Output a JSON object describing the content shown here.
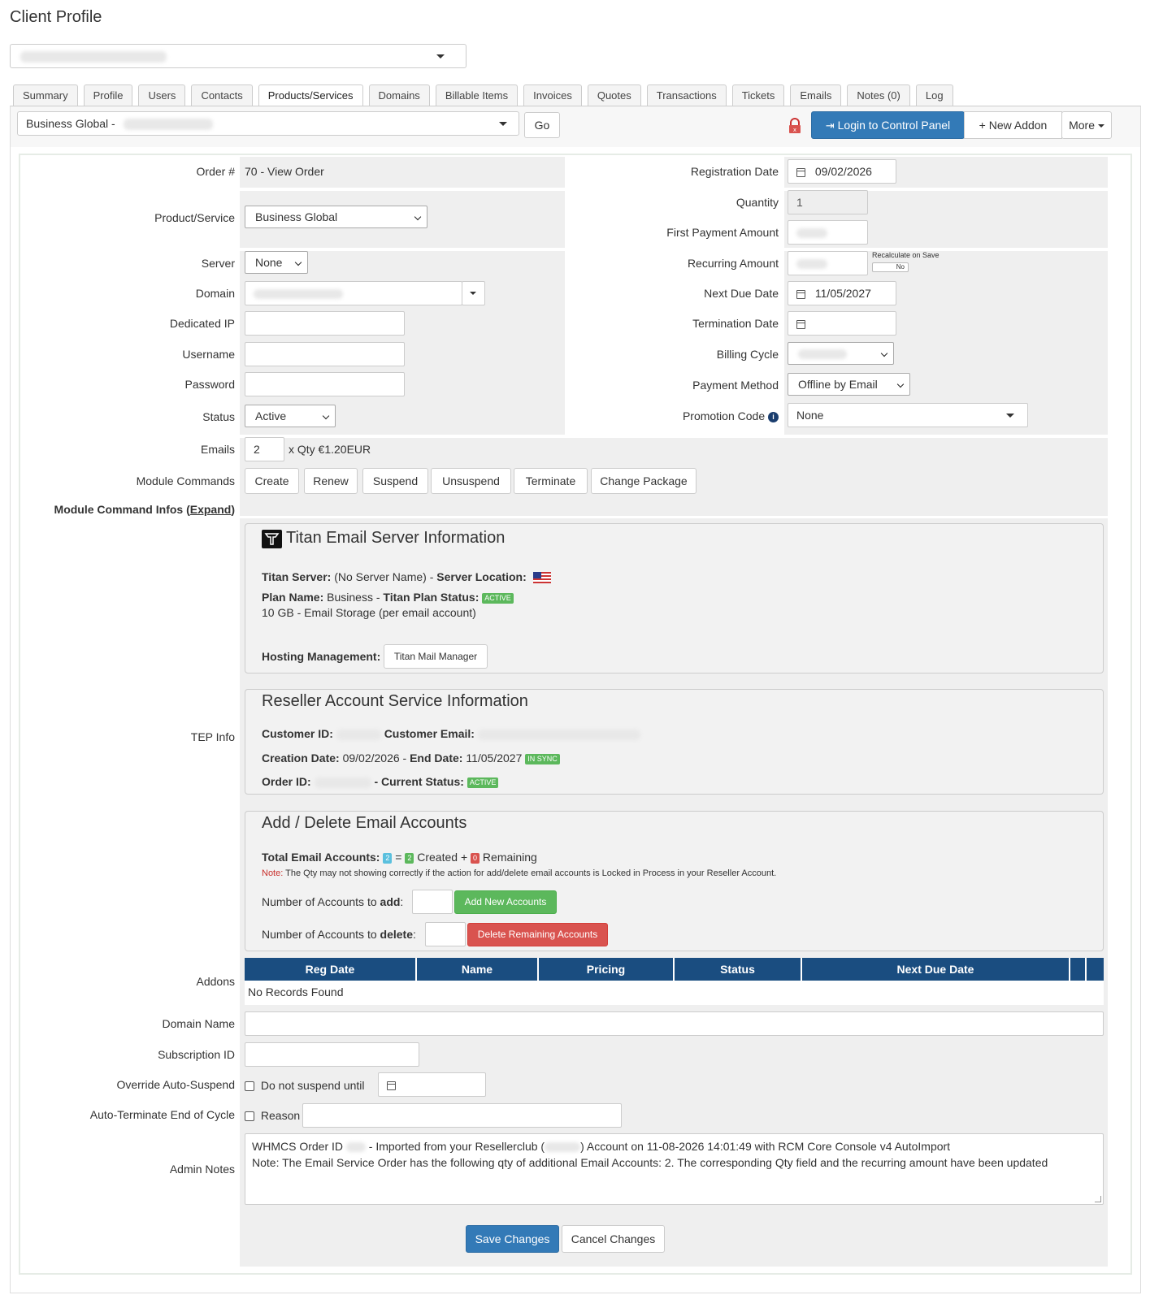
{
  "page": {
    "title": "Client Profile"
  },
  "tabs": [
    "Summary",
    "Profile",
    "Users",
    "Contacts",
    "Products/Services",
    "Domains",
    "Billable Items",
    "Invoices",
    "Quotes",
    "Transactions",
    "Tickets",
    "Emails",
    "Notes (0)",
    "Log"
  ],
  "toolbar": {
    "product_select": "Business Global -",
    "go": "Go",
    "login": "Login to Control Panel",
    "new_addon": "New Addon",
    "more": "More"
  },
  "form": {
    "order_label": "Order #",
    "order_value": "70 - View Order",
    "product_label": "Product/Service",
    "product_value": "Business Global",
    "server_label": "Server",
    "server_value": "None",
    "domain_label": "Domain",
    "dedicated_ip_label": "Dedicated IP",
    "username_label": "Username",
    "password_label": "Password",
    "status_label": "Status",
    "status_value": "Active",
    "emails_label": "Emails",
    "emails_value": "2",
    "emails_suffix": "x Qty €1.20EUR",
    "module_commands_label": "Module Commands",
    "module_commands": [
      "Create",
      "Renew",
      "Suspend",
      "Unsuspend",
      "Terminate",
      "Change Package"
    ],
    "module_infos_label": "Module Command Infos (",
    "module_infos_expand": "Expand",
    "module_infos_close": ")",
    "reg_date_label": "Registration Date",
    "reg_date_value": "09/02/2026",
    "quantity_label": "Quantity",
    "quantity_value": "1",
    "first_payment_label": "First Payment Amount",
    "recurring_label": "Recurring Amount",
    "recalculate_label": "Recalculate on Save",
    "recalculate_value": "No",
    "next_due_label": "Next Due Date",
    "next_due_value": "11/05/2027",
    "termination_label": "Termination Date",
    "billing_cycle_label": "Billing Cycle",
    "payment_method_label": "Payment Method",
    "payment_method_value": "Offline by Email",
    "promo_label": "Promotion Code",
    "promo_value": "None",
    "tep_label": "TEP Info",
    "addons_label": "Addons",
    "domain_name_label": "Domain Name",
    "subscription_label": "Subscription ID",
    "override_label": "Override Auto-Suspend",
    "override_text": "Do not suspend until",
    "autoterm_label": "Auto-Terminate End of Cycle",
    "autoterm_text": "Reason",
    "admin_notes_label": "Admin Notes",
    "admin_notes_line1a": "WHMCS Order ID",
    "admin_notes_line1b": "- Imported from your Resellerclub (",
    "admin_notes_line1c": ") Account on 11-08-2026 14:01:49 with RCM Core Console v4 AutoImport",
    "admin_notes_line2": "Note: The Email Service Order has the following qty of additional Email Accounts: 2. The corresponding Qty field and the recurring amount have been updated"
  },
  "titan": {
    "heading": "Titan Email Server Information",
    "server_label": "Titan Server:",
    "server_value": "(No Server Name) -",
    "location_label": "Server Location:",
    "plan_label": "Plan Name:",
    "plan_value": "Business -",
    "plan_status_label": "Titan Plan Status:",
    "plan_status": "ACTIVE",
    "storage": "10 GB - Email Storage (per email account)",
    "hosting_label": "Hosting Management:",
    "hosting_button": "Titan Mail Manager"
  },
  "reseller": {
    "heading": "Reseller Account Service Information",
    "customer_id_label": "Customer ID:",
    "customer_email_label": "Customer Email:",
    "creation_label": "Creation Date:",
    "creation_value": "09/02/2026 -",
    "end_label": "End Date:",
    "end_value": "11/05/2027",
    "sync_badge": "IN SYNC",
    "order_id_label": "Order ID:",
    "current_status_label": "- Current Status:",
    "current_status": "ACTIVE"
  },
  "email_accounts": {
    "heading": "Add / Delete Email Accounts",
    "total_label": "Total Email Accounts:",
    "total": "2",
    "eq": "=",
    "created": "2",
    "created_label": "Created +",
    "remaining": "0",
    "remaining_label": "Remaining",
    "note_label": "Note:",
    "note": "The Qty may not showing correctly if the action for add/delete email accounts is Locked in Process in your Reseller Account.",
    "add_label": "Number of Accounts to",
    "add_word": "add",
    "add_button": "Add New Accounts",
    "delete_label": "Number of Accounts to",
    "delete_word": "delete",
    "delete_button": "Delete Remaining Accounts"
  },
  "addons_table": {
    "columns": [
      "Reg Date",
      "Name",
      "Pricing",
      "Status",
      "Next Due Date"
    ],
    "empty": "No Records Found"
  },
  "footer": {
    "save": "Save Changes",
    "cancel": "Cancel Changes"
  },
  "colors": {
    "primary": "#337ab7",
    "header_blue": "#1a4d80",
    "success": "#5cb85c",
    "danger": "#d9534f",
    "info": "#5bc0de"
  }
}
